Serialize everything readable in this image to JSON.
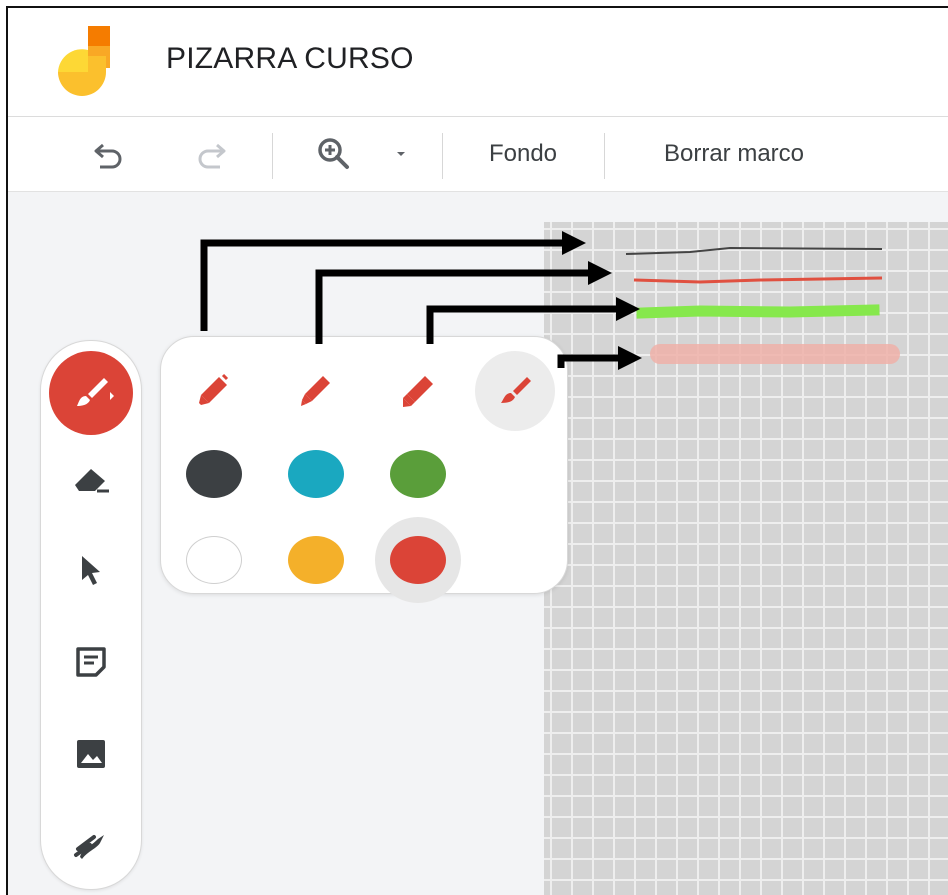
{
  "app": {
    "title": "PIZARRA CURSO"
  },
  "toolbar": {
    "fondo_label": "Fondo",
    "borrar_label": "Borrar marco",
    "icons": [
      "undo-icon",
      "redo-icon",
      "zoom-in-icon",
      "dropdown-caret-icon"
    ]
  },
  "side_tools": [
    {
      "name": "pen-tool",
      "icon": "brush-icon",
      "active": true
    },
    {
      "name": "eraser-tool",
      "icon": "eraser-icon"
    },
    {
      "name": "select-tool",
      "icon": "cursor-icon"
    },
    {
      "name": "sticky-note-tool",
      "icon": "sticky-note-icon"
    },
    {
      "name": "image-tool",
      "icon": "image-icon"
    },
    {
      "name": "laser-tool",
      "icon": "laser-icon"
    }
  ],
  "palette": {
    "pens": [
      {
        "name": "pen",
        "icon": "pen-icon"
      },
      {
        "name": "marker",
        "icon": "marker-icon"
      },
      {
        "name": "highlighter",
        "icon": "highlighter-icon"
      },
      {
        "name": "brush",
        "icon": "brush-icon",
        "selected": true
      }
    ],
    "colors": [
      {
        "name": "black",
        "hex": "#3c4043"
      },
      {
        "name": "blue",
        "hex": "#1aa8c0"
      },
      {
        "name": "green",
        "hex": "#5a9e3a"
      },
      {
        "name": "white",
        "hex": "#ffffff"
      },
      {
        "name": "yellow",
        "hex": "#f4b02a"
      },
      {
        "name": "red",
        "hex": "#db4437",
        "selected": true
      }
    ]
  },
  "strokes": [
    {
      "tool": "pen",
      "color": "#444444"
    },
    {
      "tool": "marker",
      "color": "#e05040"
    },
    {
      "tool": "highlighter",
      "color": "#86e84c"
    },
    {
      "tool": "brush",
      "color": "#efb0a8"
    }
  ],
  "colors": {
    "accent": "#db4437",
    "grid": "#d4d4d4"
  }
}
